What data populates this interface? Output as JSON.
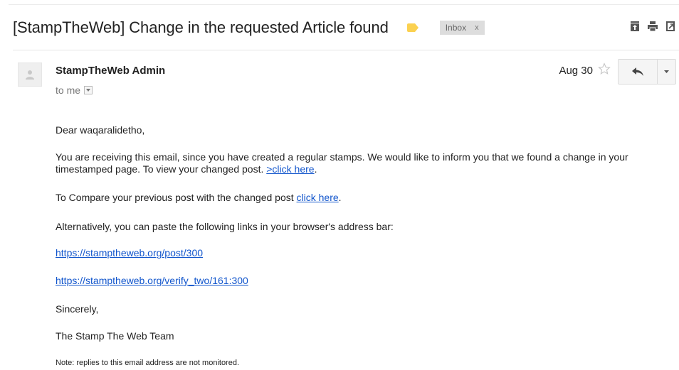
{
  "subject": "[StampTheWeb] Change in the requested Article found",
  "label_color": "#fbd150",
  "inbox_chip": {
    "label": "Inbox",
    "close": "x"
  },
  "toolbar_icons": [
    "archive-icon",
    "print-icon",
    "new-window-icon"
  ],
  "sender": {
    "name": "StampTheWeb Admin",
    "recipient": "to me",
    "avatar_icon": "person-icon"
  },
  "date": "Aug 30",
  "link_color": "#1155cc",
  "body": {
    "greeting": "Dear waqaralidetho,",
    "receiving_text": "You are receiving this email, since you have created a regular stamps. We would like to inform you that we found a change in your timestamped page. To view your changed post.",
    "receiving_link": ">click here",
    "compare_text": "To Compare your previous post with the changed post",
    "compare_link": "click here",
    "alternatively": "Alternatively, you can paste the following links in your browser's address bar:",
    "link1": "https://stamptheweb.org/post/300",
    "link2": "https://stamptheweb.org/verify_two/161:300",
    "sincerely": "Sincerely,",
    "signature": "The Stamp The Web Team",
    "note": "Note: replies to this email address are not monitored."
  }
}
